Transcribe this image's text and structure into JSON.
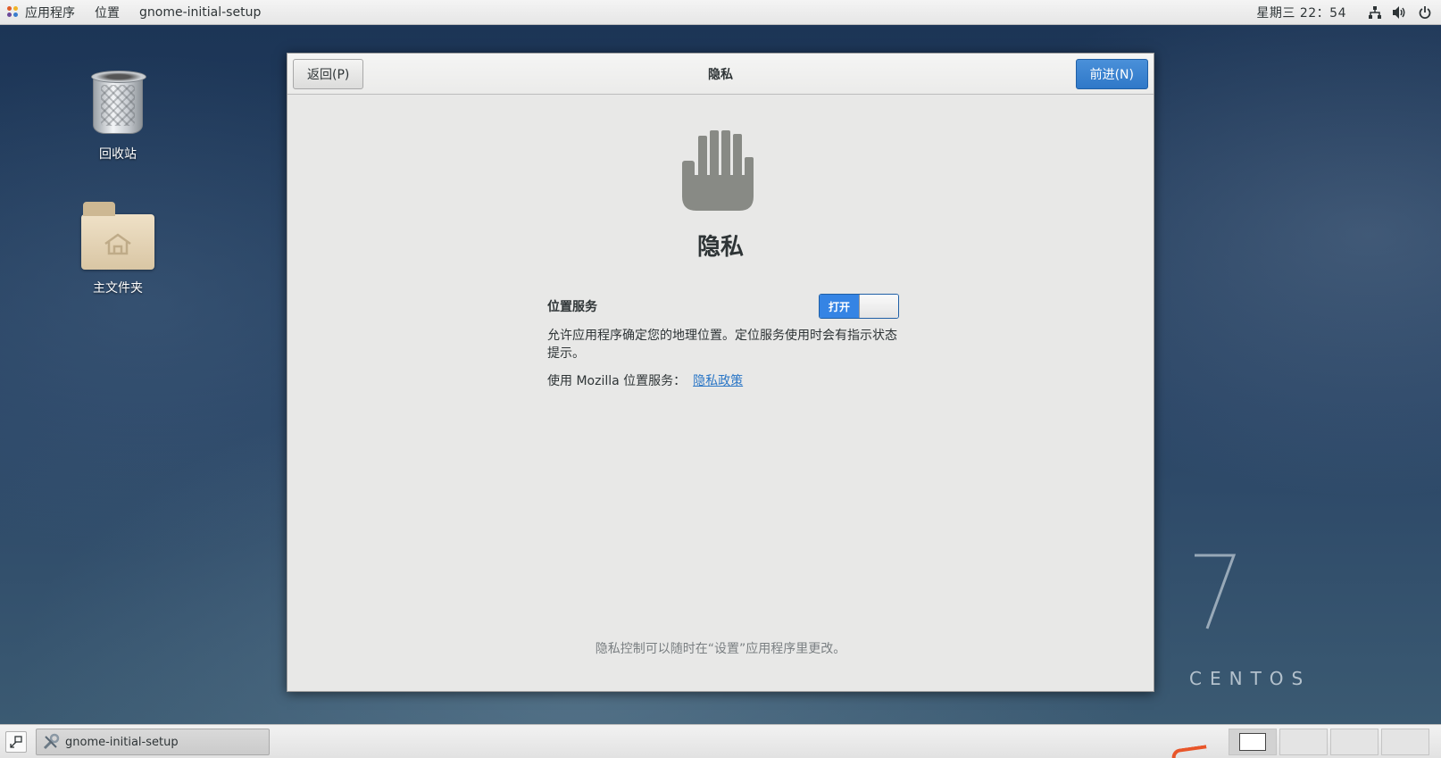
{
  "topbar": {
    "apps_label": "应用程序",
    "places_label": "位置",
    "app_name": "gnome-initial-setup",
    "clock": "星期三 22：54"
  },
  "desktop": {
    "trash_label": "回收站",
    "home_label": "主文件夹",
    "watermark_number": "7",
    "watermark_text": "CENTOS"
  },
  "dialog": {
    "back_button": "返回(P)",
    "title": "隐私",
    "next_button": "前进(N)",
    "heading": "隐私",
    "location_label": "位置服务",
    "switch_on_label": "打开",
    "description": "允许应用程序确定您的地理位置。定位服务使用时会有指示状态提示。",
    "mozilla_text": "使用 Mozilla 位置服务：",
    "privacy_link": "隐私政策",
    "footer_note": "隐私控制可以随时在“设置”应用程序里更改。"
  },
  "taskbar": {
    "task_label": "gnome-initial-setup"
  },
  "colors": {
    "accent": "#3584e4",
    "link": "#2a76c6"
  }
}
